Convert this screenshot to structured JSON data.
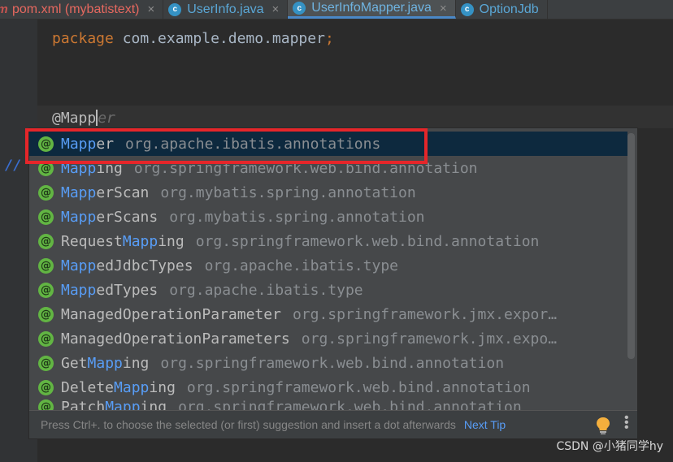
{
  "tabs": [
    {
      "label": "pom.xml (mybatistext)",
      "type": "xml",
      "active": false,
      "closable": true
    },
    {
      "label": "UserInfo.java",
      "type": "java",
      "active": false,
      "closable": true
    },
    {
      "label": "UserInfoMapper.java",
      "type": "java",
      "active": true,
      "closable": true
    },
    {
      "label": "OptionJdb",
      "type": "java",
      "active": false,
      "closable": false
    }
  ],
  "tab_close_glyph": "×",
  "tab_class_glyph": "c",
  "tab_maven_glyph": "m",
  "editor": {
    "package_keyword": "package",
    "package_name": " com.example.demo.mapper",
    "semicolon": ";",
    "annotation_typed": "@Mapp",
    "annotation_rest": "er"
  },
  "completion": {
    "icon_glyph": "@",
    "items": [
      {
        "pre": "",
        "hl": "Mapp",
        "post": "er",
        "pkg": "org.apache.ibatis.annotations",
        "selected": true
      },
      {
        "pre": "",
        "hl": "Mapp",
        "post": "ing",
        "pkg": "org.springframework.web.bind.annotation",
        "selected": false
      },
      {
        "pre": "",
        "hl": "Mapp",
        "post": "erScan",
        "pkg": "org.mybatis.spring.annotation",
        "selected": false
      },
      {
        "pre": "",
        "hl": "Mapp",
        "post": "erScans",
        "pkg": "org.mybatis.spring.annotation",
        "selected": false
      },
      {
        "pre": "Request",
        "hl": "Mapp",
        "post": "ing",
        "pkg": "org.springframework.web.bind.annotation",
        "selected": false
      },
      {
        "pre": "",
        "hl": "Mapp",
        "post": "edJdbcTypes",
        "pkg": "org.apache.ibatis.type",
        "selected": false
      },
      {
        "pre": "",
        "hl": "Mapp",
        "post": "edTypes",
        "pkg": "org.apache.ibatis.type",
        "selected": false
      },
      {
        "pre": "ManagedOperationParameter",
        "hl": "",
        "post": "",
        "pkg": "org.springframework.jmx.expor…",
        "selected": false
      },
      {
        "pre": "ManagedOperationParameters",
        "hl": "",
        "post": "",
        "pkg": "org.springframework.jmx.expo…",
        "selected": false
      },
      {
        "pre": "Get",
        "hl": "Mapp",
        "post": "ing",
        "pkg": "org.springframework.web.bind.annotation",
        "selected": false
      },
      {
        "pre": "Delete",
        "hl": "Mapp",
        "post": "ing",
        "pkg": "org.springframework.web.bind.annotation",
        "selected": false
      },
      {
        "pre": "Patch",
        "hl": "Mapp",
        "post": "ing",
        "pkg": "org.springframework.web.bind.annotation",
        "selected": false
      }
    ],
    "footer_hint": "Press Ctrl+. to choose the selected (or first) suggestion and insert a dot afterwards",
    "footer_link": "Next Tip",
    "more_glyph": "⋮"
  },
  "watermark": "CSDN @小猪同学hy",
  "colors": {
    "background": "#2b2b2b",
    "popup_bg": "#46484a",
    "selection": "#0d293e",
    "match_highlight": "#589df6",
    "annotation_icon": "#62b543",
    "keyword": "#cc7832",
    "red_box": "#e5262a"
  }
}
